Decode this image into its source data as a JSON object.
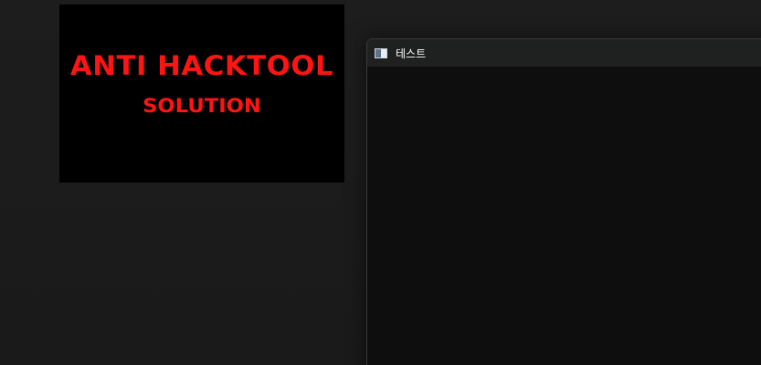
{
  "splash": {
    "line1": "ANTI HACKTOOL",
    "line2": "SOLUTION"
  },
  "window": {
    "title": "테스트",
    "icon": "application-window-icon"
  },
  "colors": {
    "desktop_bg": "#1c1c1c",
    "splash_bg": "#000000",
    "splash_text": "#ff1414",
    "titlebar_bg": "#1f2020",
    "client_bg": "#0e0e0e"
  }
}
